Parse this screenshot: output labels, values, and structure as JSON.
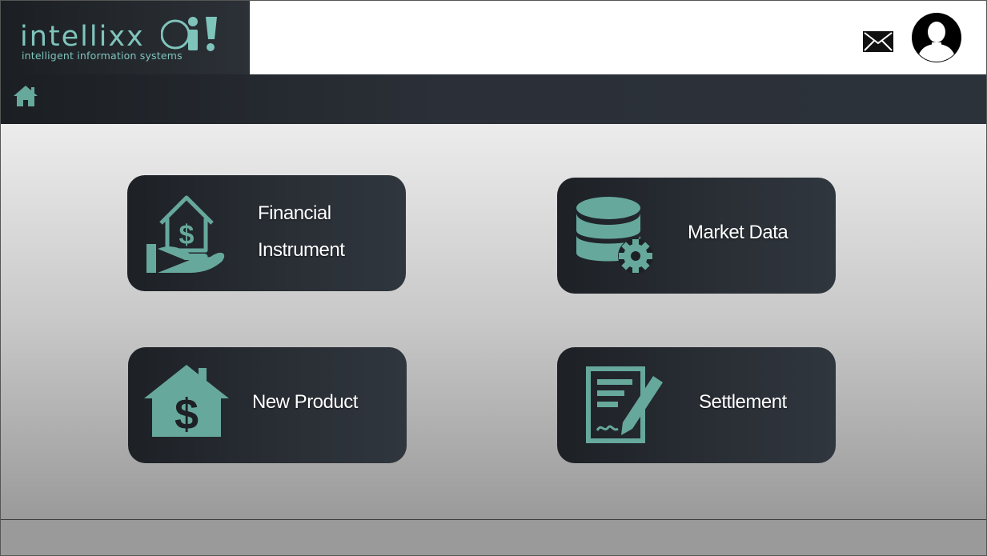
{
  "header": {
    "logo": {
      "wordmark": "intellixx",
      "tagline": "intelligent information systems"
    },
    "mail_icon": "envelope-icon",
    "avatar_icon": "user-avatar-icon"
  },
  "navbar": {
    "home_icon": "home-icon"
  },
  "tiles": [
    {
      "label_line1": "Financial",
      "label_line2": "Instrument",
      "icon": "house-dollar-hand-icon"
    },
    {
      "label": "Market Data",
      "icon": "database-gear-icon"
    },
    {
      "label": "New Product",
      "icon": "house-dollar-icon"
    },
    {
      "label": "Settlement",
      "icon": "document-pen-icon"
    }
  ],
  "colors": {
    "accent": "#67a89d",
    "logo_text": "#7fc4bb",
    "dark_bar": "#2b3038",
    "label_text": "#ffffff"
  }
}
